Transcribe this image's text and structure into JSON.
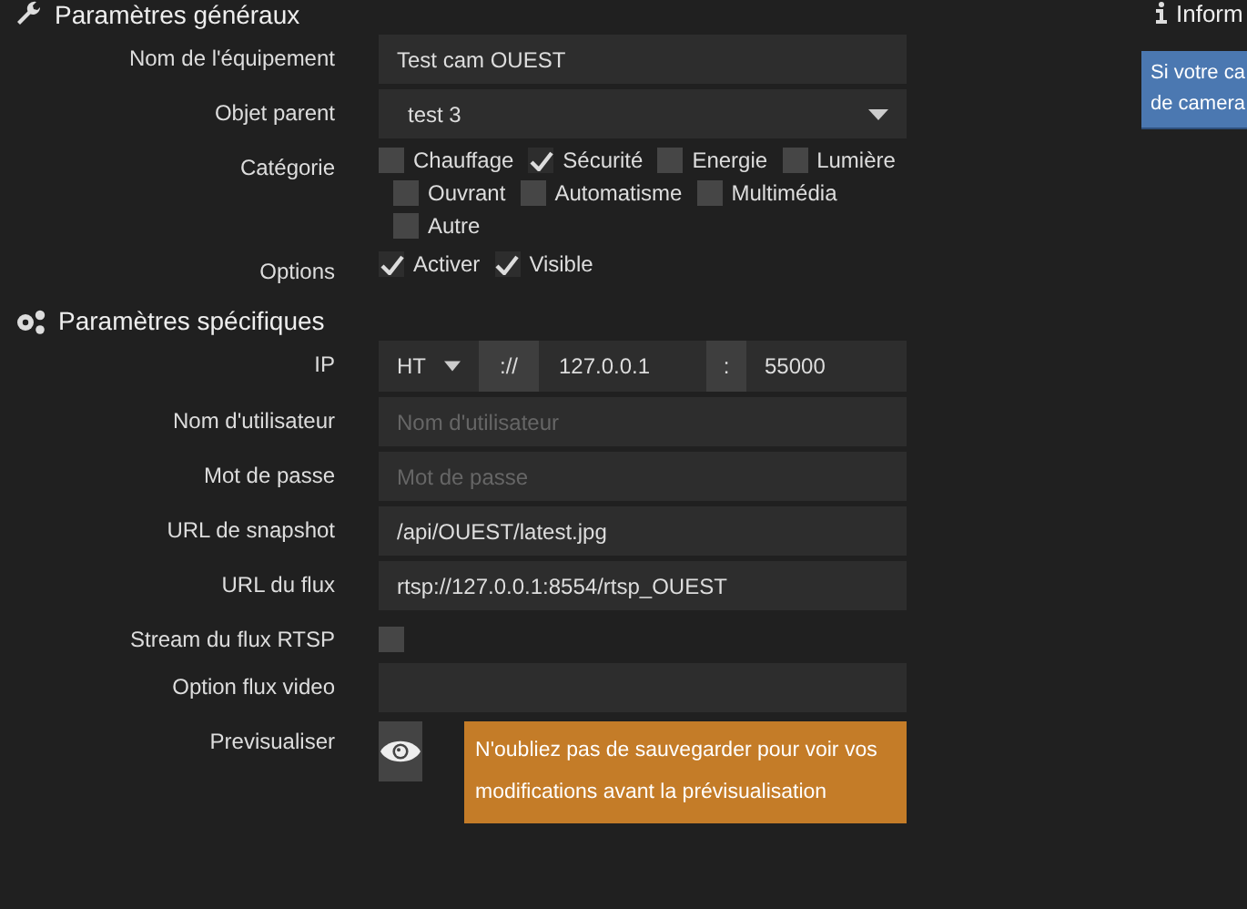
{
  "general": {
    "title": "Paramètres généraux",
    "fields": [
      {
        "kind": "text",
        "label": "Nom de l'équipement",
        "value": "Test cam OUEST"
      },
      {
        "kind": "select",
        "label": "Objet parent",
        "value": "test 3"
      },
      {
        "kind": "checks",
        "label": "Catégorie",
        "rows": [
          [
            {
              "label": "Chauffage",
              "checked": false
            },
            {
              "label": "Sécurité",
              "checked": true
            },
            {
              "label": "Energie",
              "checked": false
            },
            {
              "label": "Lumière",
              "checked": false
            }
          ],
          [
            {
              "label": "Ouvrant",
              "checked": false
            },
            {
              "label": "Automatisme",
              "checked": false
            },
            {
              "label": "Multimédia",
              "checked": false
            }
          ],
          [
            {
              "label": "Autre",
              "checked": false
            }
          ]
        ]
      },
      {
        "kind": "checks",
        "label": "Options",
        "rows": [
          [
            {
              "label": "Activer",
              "checked": true
            },
            {
              "label": "Visible",
              "checked": true
            }
          ]
        ]
      }
    ]
  },
  "specific": {
    "title": "Paramètres spécifiques",
    "fields": [
      {
        "kind": "ip",
        "label": "IP",
        "protocol": "HT",
        "separator": "://",
        "host": "127.0.0.1",
        "colon": ":",
        "port": "55000"
      },
      {
        "kind": "text",
        "label": "Nom d'utilisateur",
        "placeholder": "Nom d'utilisateur"
      },
      {
        "kind": "text",
        "label": "Mot de passe",
        "placeholder": "Mot de passe"
      },
      {
        "kind": "text",
        "label": "URL de snapshot",
        "value": "/api/OUEST/latest.jpg"
      },
      {
        "kind": "text",
        "label": "URL du flux",
        "value": "rtsp://127.0.0.1:8554/rtsp_OUEST"
      },
      {
        "kind": "checkbox",
        "label": "Stream du flux RTSP",
        "checked": false
      },
      {
        "kind": "text",
        "label": "Option flux video"
      },
      {
        "kind": "preview",
        "label": "Previsualiser",
        "notice": "N'oubliez pas de sauvegarder pour voir vos modifications avant la prévisualisation"
      }
    ]
  },
  "info": {
    "title": "Inform",
    "lines": [
      "Si votre ca",
      "de camera"
    ]
  }
}
